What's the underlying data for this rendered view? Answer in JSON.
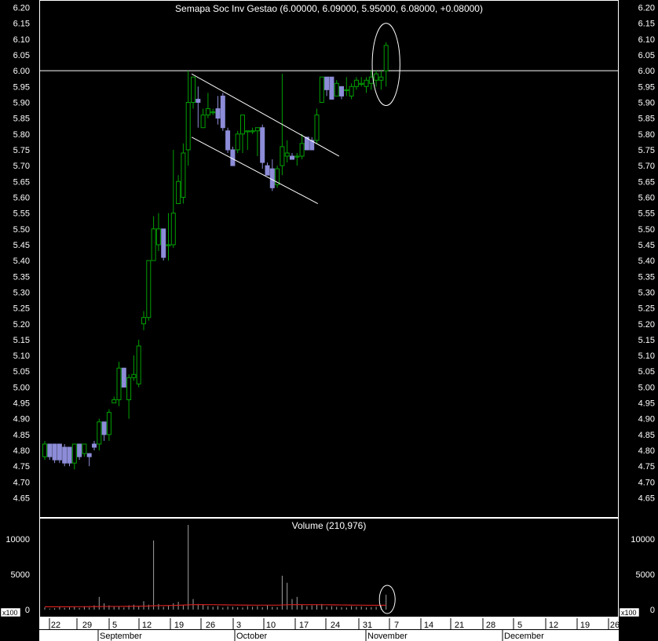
{
  "chart_data": [
    {
      "type": "candlestick",
      "title": "Semapa Soc Inv Gestao (6.00000, 6.09000, 5.95000, 6.08000, +0.08000)",
      "ylim": [
        4.6,
        6.22
      ],
      "yticks": [
        4.65,
        4.7,
        4.75,
        4.8,
        4.85,
        4.9,
        4.95,
        5.0,
        5.05,
        5.1,
        5.15,
        5.2,
        5.25,
        5.3,
        5.35,
        5.4,
        5.45,
        5.5,
        5.55,
        5.6,
        5.65,
        5.7,
        5.75,
        5.8,
        5.85,
        5.9,
        5.95,
        6.0,
        6.05,
        6.1,
        6.15,
        6.2
      ],
      "ytick_labels": [
        "4.65",
        "4.70",
        "4.75",
        "4.80",
        "4.85",
        "4.90",
        "4.95",
        "5.00",
        "5.05",
        "5.10",
        "5.15",
        "5.20",
        "5.25",
        "5.30",
        "5.35",
        "5.40",
        "5.45",
        "5.50",
        "5.55",
        "5.60",
        "5.65",
        "5.70",
        "5.75",
        "5.80",
        "5.85",
        "5.90",
        "5.95",
        "6.00",
        "6.05",
        "6.10",
        "6.15",
        "6.20"
      ],
      "horizontal_line": 6.0,
      "colors": {
        "up": "#00a000",
        "down": "#8c8cd8",
        "background": "#000000",
        "axis_text": "#ffffff",
        "line": "#ffffff"
      },
      "grid": false,
      "candles": [
        {
          "o": 4.78,
          "h": 4.83,
          "l": 4.77,
          "c": 4.82
        },
        {
          "o": 4.82,
          "h": 4.82,
          "l": 4.77,
          "c": 4.78
        },
        {
          "o": 4.82,
          "h": 4.82,
          "l": 4.76,
          "c": 4.77
        },
        {
          "o": 4.82,
          "h": 4.82,
          "l": 4.76,
          "c": 4.77
        },
        {
          "o": 4.81,
          "h": 4.82,
          "l": 4.75,
          "c": 4.76
        },
        {
          "o": 4.81,
          "h": 4.81,
          "l": 4.75,
          "c": 4.76
        },
        {
          "o": 4.76,
          "h": 4.82,
          "l": 4.74,
          "c": 4.82
        },
        {
          "o": 4.82,
          "h": 4.82,
          "l": 4.77,
          "c": 4.78
        },
        {
          "o": 4.79,
          "h": 4.82,
          "l": 4.78,
          "c": 4.82
        },
        {
          "o": 4.79,
          "h": 4.79,
          "l": 4.75,
          "c": 4.78
        },
        {
          "o": 4.82,
          "h": 4.83,
          "l": 4.8,
          "c": 4.81
        },
        {
          "o": 4.82,
          "h": 4.9,
          "l": 4.8,
          "c": 4.89
        },
        {
          "o": 4.89,
          "h": 4.89,
          "l": 4.83,
          "c": 4.85
        },
        {
          "o": 4.85,
          "h": 4.93,
          "l": 4.83,
          "c": 4.92
        },
        {
          "o": 4.95,
          "h": 4.97,
          "l": 4.95,
          "c": 4.96
        },
        {
          "o": 4.96,
          "h": 5.08,
          "l": 4.94,
          "c": 5.06
        },
        {
          "o": 5.06,
          "h": 5.06,
          "l": 5.0,
          "c": 5.0
        },
        {
          "o": 4.96,
          "h": 5.04,
          "l": 4.9,
          "c": 5.03
        },
        {
          "o": 5.03,
          "h": 5.1,
          "l": 5.02,
          "c": 5.04
        },
        {
          "o": 5.01,
          "h": 5.15,
          "l": 5.0,
          "c": 5.13
        },
        {
          "o": 5.2,
          "h": 5.24,
          "l": 5.18,
          "c": 5.22
        },
        {
          "o": 5.22,
          "h": 5.4,
          "l": 5.21,
          "c": 5.4
        },
        {
          "o": 5.4,
          "h": 5.54,
          "l": 5.4,
          "c": 5.5
        },
        {
          "o": 5.45,
          "h": 5.55,
          "l": 5.43,
          "c": 5.5
        },
        {
          "o": 5.5,
          "h": 5.5,
          "l": 5.4,
          "c": 5.41
        },
        {
          "o": 5.45,
          "h": 5.55,
          "l": 5.4,
          "c": 5.45
        },
        {
          "o": 5.45,
          "h": 5.75,
          "l": 5.44,
          "c": 5.55
        },
        {
          "o": 5.58,
          "h": 5.67,
          "l": 5.58,
          "c": 5.65
        },
        {
          "o": 5.6,
          "h": 5.77,
          "l": 5.58,
          "c": 5.74
        },
        {
          "o": 5.75,
          "h": 6.0,
          "l": 5.7,
          "c": 5.9
        },
        {
          "o": 5.9,
          "h": 5.98,
          "l": 5.88,
          "c": 5.98
        },
        {
          "o": 5.91,
          "h": 5.95,
          "l": 5.82,
          "c": 5.9
        },
        {
          "o": 5.82,
          "h": 5.88,
          "l": 5.82,
          "c": 5.86
        },
        {
          "o": 5.86,
          "h": 5.93,
          "l": 5.85,
          "c": 5.88
        },
        {
          "o": 5.87,
          "h": 5.88,
          "l": 5.86,
          "c": 5.87
        },
        {
          "o": 5.88,
          "h": 5.92,
          "l": 5.83,
          "c": 5.85
        },
        {
          "o": 5.92,
          "h": 5.93,
          "l": 5.81,
          "c": 5.82
        },
        {
          "o": 5.81,
          "h": 5.82,
          "l": 5.74,
          "c": 5.75
        },
        {
          "o": 5.75,
          "h": 5.76,
          "l": 5.7,
          "c": 5.7
        },
        {
          "o": 5.75,
          "h": 5.81,
          "l": 5.74,
          "c": 5.8
        },
        {
          "o": 5.8,
          "h": 5.86,
          "l": 5.74,
          "c": 5.86
        },
        {
          "o": 5.81,
          "h": 5.81,
          "l": 5.75,
          "c": 5.81
        },
        {
          "o": 5.81,
          "h": 5.82,
          "l": 5.8,
          "c": 5.81
        },
        {
          "o": 5.81,
          "h": 5.82,
          "l": 5.73,
          "c": 5.82
        },
        {
          "o": 5.82,
          "h": 5.83,
          "l": 5.69,
          "c": 5.71
        },
        {
          "o": 5.7,
          "h": 5.71,
          "l": 5.67,
          "c": 5.67
        },
        {
          "o": 5.69,
          "h": 5.72,
          "l": 5.62,
          "c": 5.63
        },
        {
          "o": 5.64,
          "h": 5.7,
          "l": 5.63,
          "c": 5.69
        },
        {
          "o": 5.7,
          "h": 5.99,
          "l": 5.67,
          "c": 5.76
        },
        {
          "o": 5.73,
          "h": 5.78,
          "l": 5.71,
          "c": 5.74
        },
        {
          "o": 5.73,
          "h": 5.74,
          "l": 5.72,
          "c": 5.72
        },
        {
          "o": 5.73,
          "h": 5.74,
          "l": 5.7,
          "c": 5.73
        },
        {
          "o": 5.73,
          "h": 5.8,
          "l": 5.72,
          "c": 5.77
        },
        {
          "o": 5.79,
          "h": 5.79,
          "l": 5.75,
          "c": 5.75
        },
        {
          "o": 5.78,
          "h": 5.79,
          "l": 5.75,
          "c": 5.75
        },
        {
          "o": 5.78,
          "h": 5.88,
          "l": 5.77,
          "c": 5.86
        },
        {
          "o": 5.9,
          "h": 5.98,
          "l": 5.9,
          "c": 5.98
        },
        {
          "o": 5.98,
          "h": 5.98,
          "l": 5.92,
          "c": 5.94
        },
        {
          "o": 5.98,
          "h": 5.98,
          "l": 5.91,
          "c": 5.91
        },
        {
          "o": 5.92,
          "h": 5.97,
          "l": 5.92,
          "c": 5.96
        },
        {
          "o": 5.95,
          "h": 5.95,
          "l": 5.91,
          "c": 5.92
        },
        {
          "o": 5.94,
          "h": 5.98,
          "l": 5.92,
          "c": 5.94
        },
        {
          "o": 5.92,
          "h": 5.96,
          "l": 5.91,
          "c": 5.95
        },
        {
          "o": 5.95,
          "h": 5.98,
          "l": 5.94,
          "c": 5.97
        },
        {
          "o": 5.96,
          "h": 5.98,
          "l": 5.95,
          "c": 5.96
        },
        {
          "o": 5.95,
          "h": 5.98,
          "l": 5.93,
          "c": 5.97
        },
        {
          "o": 5.96,
          "h": 6.0,
          "l": 5.94,
          "c": 5.98
        },
        {
          "o": 5.97,
          "h": 6.0,
          "l": 5.95,
          "c": 5.99
        },
        {
          "o": 5.97,
          "h": 6.0,
          "l": 5.94,
          "c": 5.98
        },
        {
          "o": 6.0,
          "h": 6.09,
          "l": 5.95,
          "c": 6.08
        }
      ],
      "trend_lines": [
        {
          "from": [
            29.7,
            5.99
          ],
          "to": [
            59.5,
            5.73
          ]
        },
        {
          "from": [
            29.7,
            5.79
          ],
          "to": [
            55.2,
            5.58
          ]
        }
      ],
      "highlight_ellipse": {
        "center": [
          69,
          6.02
        ],
        "radius_x": 2.8,
        "radius_y": 0.13
      }
    },
    {
      "type": "bar",
      "title": "Volume (210,976)",
      "ylim": [
        -600,
        12800
      ],
      "yticks": [
        0,
        5000,
        10000
      ],
      "ytick_labels": [
        "0",
        "5000",
        "10000"
      ],
      "unit_label": "x100",
      "colors": {
        "bars": "#a0a0a0",
        "average": "#d02020"
      },
      "values": [
        300,
        150,
        200,
        350,
        250,
        300,
        400,
        250,
        500,
        300,
        600,
        1800,
        900,
        600,
        400,
        500,
        300,
        600,
        700,
        500,
        1200,
        700,
        9800,
        800,
        400,
        600,
        900,
        1100,
        700,
        12000,
        1500,
        800,
        700,
        500,
        400,
        500,
        300,
        450,
        400,
        350,
        300,
        500,
        400,
        500,
        350,
        600,
        400,
        350,
        4800,
        3800,
        1500,
        1800,
        700,
        500,
        600,
        700,
        800,
        400,
        500,
        400,
        350,
        300,
        500,
        400,
        450,
        300,
        350,
        400,
        500,
        2100
      ],
      "moving_average": [
        400,
        400,
        400,
        400,
        400,
        400,
        410,
        410,
        410,
        420,
        430,
        430,
        440,
        450,
        450,
        450,
        460,
        470,
        480,
        490,
        500,
        510,
        540,
        560,
        570,
        580,
        590,
        610,
        640,
        680,
        700,
        710,
        710,
        700,
        700,
        690,
        680,
        670,
        660,
        650,
        640,
        640,
        630,
        630,
        630,
        630,
        630,
        630,
        660,
        690,
        700,
        710,
        700,
        700,
        700,
        700,
        690,
        690,
        680,
        670,
        660,
        650,
        640,
        630,
        630,
        620,
        610,
        610,
        610,
        630
      ]
    }
  ],
  "x_axis": {
    "day_labels": [
      "22",
      "29",
      "5",
      "12",
      "19",
      "26",
      "3",
      "10",
      "17",
      "24",
      "31",
      "7",
      "14",
      "21",
      "28",
      "5",
      "12",
      "19",
      "26"
    ],
    "month_labels": [
      "September",
      "October",
      "November",
      "December"
    ]
  }
}
